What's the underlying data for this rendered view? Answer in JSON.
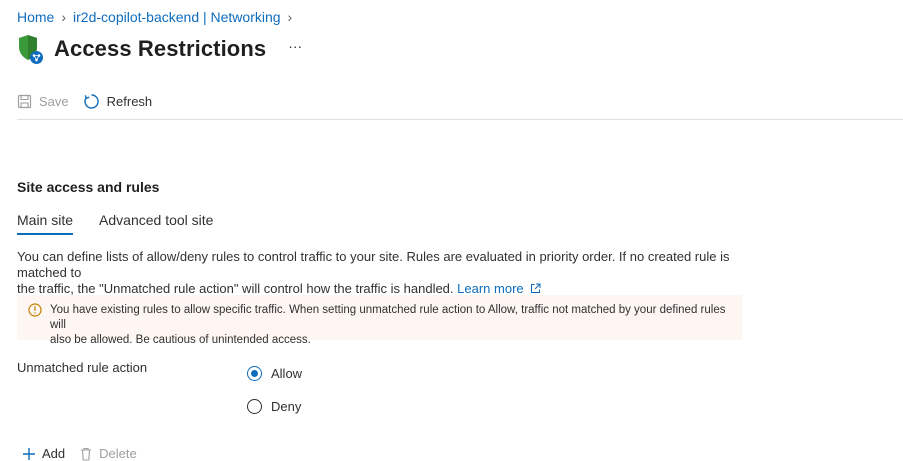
{
  "breadcrumb": {
    "items": [
      {
        "label": "Home"
      },
      {
        "label": "ir2d-copilot-backend | Networking"
      }
    ]
  },
  "page": {
    "title": "Access Restrictions",
    "more": "···"
  },
  "toolbar": {
    "save_label": "Save",
    "refresh_label": "Refresh"
  },
  "section": {
    "title": "Site access and rules"
  },
  "tabs": [
    {
      "label": "Main site",
      "active": true
    },
    {
      "label": "Advanced tool site",
      "active": false
    }
  ],
  "description": {
    "line1": "You can define lists of allow/deny rules to control traffic to your site. Rules are evaluated in priority order. If no created rule is matched to",
    "line2": "the traffic, the \"Unmatched rule action\" will control how the traffic is handled.",
    "learn_more": "Learn more"
  },
  "alert": {
    "line1": "You have existing rules to allow specific traffic. When setting unmatched rule action to Allow, traffic not matched by your defined rules will",
    "line2": "also be allowed. Be cautious of unintended access."
  },
  "unmatched_rule": {
    "label": "Unmatched rule action",
    "options": [
      {
        "label": "Allow",
        "checked": true
      },
      {
        "label": "Deny",
        "checked": false
      }
    ]
  },
  "rules_toolbar": {
    "add_label": "Add",
    "delete_label": "Delete"
  },
  "colors": {
    "accent": "#0f6cbd",
    "shield_green": "#3a9a3a",
    "alert_bg": "#fdf6f3",
    "alert_icon": "#c47f00"
  }
}
